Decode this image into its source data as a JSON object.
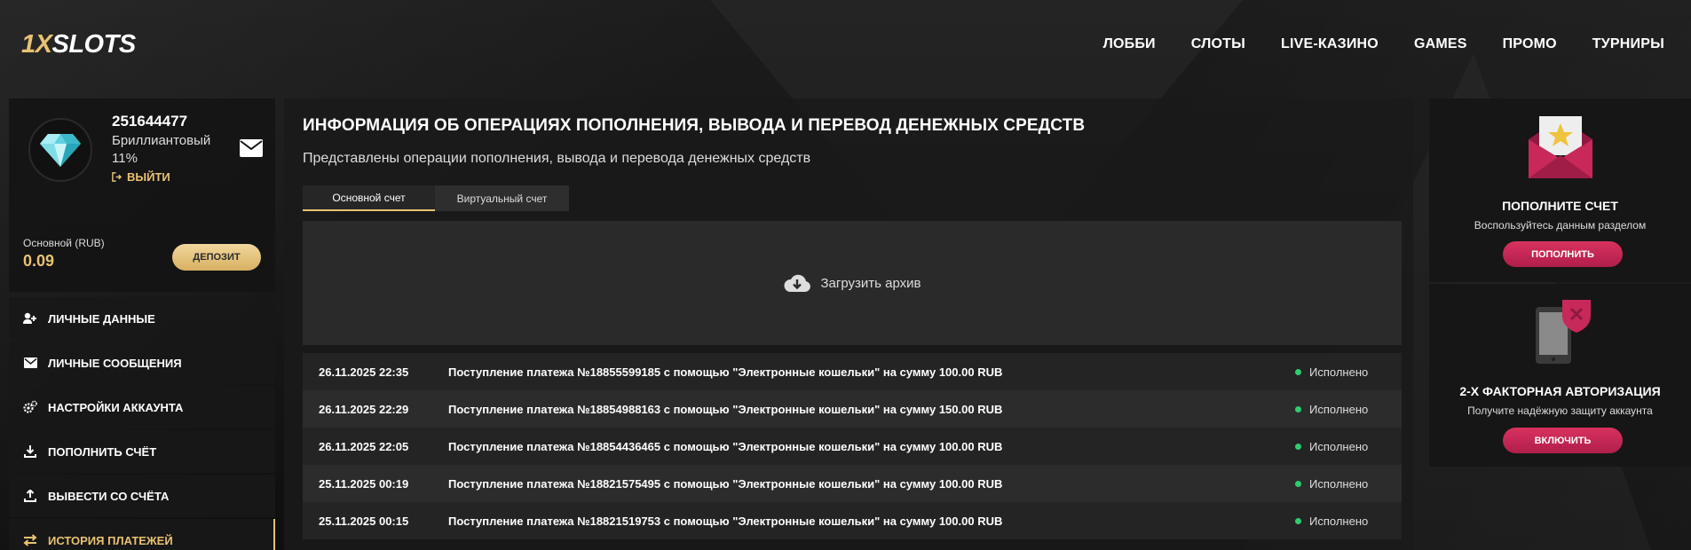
{
  "header": {
    "logo_part1": "1X",
    "logo_part2": "SLOTS",
    "nav": [
      "ЛОББИ",
      "СЛОТЫ",
      "LIVE-КАЗИНО",
      "GAMES",
      "ПРОМО",
      "ТУРНИРЫ"
    ]
  },
  "profile": {
    "user_id": "251644477",
    "rank": "Бриллиантовый",
    "progress": "11%",
    "logout": "ВЫЙТИ",
    "balance_label": "Основной (RUB)",
    "balance": "0.09",
    "deposit": "ДЕПОЗИТ"
  },
  "menu": [
    {
      "label": "ЛИЧНЫЕ ДАННЫЕ",
      "icon": "user-plus-icon"
    },
    {
      "label": "ЛИЧНЫЕ СООБЩЕНИЯ",
      "icon": "envelope-icon"
    },
    {
      "label": "НАСТРОЙКИ АККАУНТА",
      "icon": "gears-icon"
    },
    {
      "label": "ПОПОЛНИТЬ СЧЁТ",
      "icon": "download-icon"
    },
    {
      "label": "ВЫВЕСТИ СО СЧЁТА",
      "icon": "upload-icon"
    },
    {
      "label": "ИСТОРИЯ ПЛАТЕЖЕЙ",
      "icon": "exchange-icon",
      "active": true
    }
  ],
  "main": {
    "title": "ИНФОРМАЦИЯ ОБ ОПЕРАЦИЯХ ПОПОЛНЕНИЯ, ВЫВОДА И ПЕРЕВОД ДЕНЕЖНЫХ СРЕДСТВ",
    "subtitle": "Представлены операции пополнения, вывода и перевода денежных средств",
    "tabs": [
      "Основной счет",
      "Виртуальный счет"
    ],
    "archive": "Загрузить архив",
    "rows": [
      {
        "date": "26.11.2025 22:35",
        "desc": "Поступление платежа №18855599185 с помощью \"Электронные кошельки\" на сумму 100.00 RUB",
        "status": "Исполнено"
      },
      {
        "date": "26.11.2025 22:29",
        "desc": "Поступление платежа №18854988163 с помощью \"Электронные кошельки\" на сумму 150.00 RUB",
        "status": "Исполнено"
      },
      {
        "date": "26.11.2025 22:05",
        "desc": "Поступление платежа №18854436465 с помощью \"Электронные кошельки\" на сумму 100.00 RUB",
        "status": "Исполнено"
      },
      {
        "date": "25.11.2025 00:19",
        "desc": "Поступление платежа №18821575495 с помощью \"Электронные кошельки\" на сумму 100.00 RUB",
        "status": "Исполнено"
      },
      {
        "date": "25.11.2025 00:15",
        "desc": "Поступление платежа №18821519753 с помощью \"Электронные кошельки\" на сумму 100.00 RUB",
        "status": "Исполнено"
      }
    ]
  },
  "right": {
    "card1": {
      "title": "ПОПОЛНИТЕ СЧЕТ",
      "subtitle": "Воспользуйтесь данным разделом",
      "button": "ПОПОЛНИТЬ"
    },
    "card2": {
      "title": "2-Х ФАКТОРНАЯ АВТОРИЗАЦИЯ",
      "subtitle": "Получите надёжную защиту аккаунта",
      "button": "ВКЛЮЧИТЬ"
    }
  },
  "colors": {
    "accent_gold": "#e8c273",
    "accent_red": "#c8285a",
    "status_green": "#2ecc71"
  }
}
